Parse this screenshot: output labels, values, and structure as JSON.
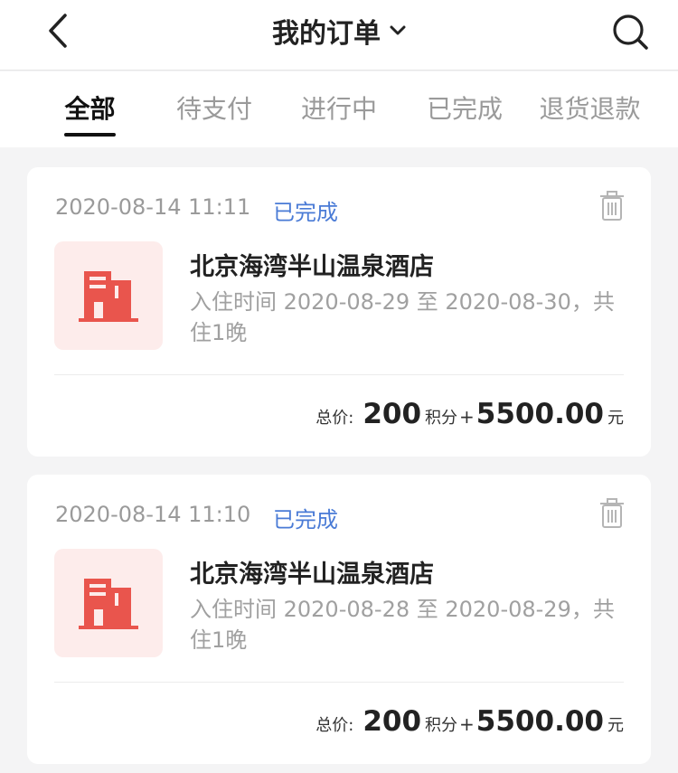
{
  "header": {
    "title": "我的订单",
    "back_icon": "back-arrow-icon",
    "dropdown_icon": "chevron-down-icon",
    "search_icon": "search-icon"
  },
  "tabs": [
    {
      "label": "全部",
      "active": true
    },
    {
      "label": "待支付",
      "active": false
    },
    {
      "label": "进行中",
      "active": false
    },
    {
      "label": "已完成",
      "active": false
    },
    {
      "label": "退货退款",
      "active": false
    }
  ],
  "orders": [
    {
      "date": "2020-08-14 11:11",
      "status": "已完成",
      "hotel": "北京海湾半山温泉酒店",
      "stay": "入住时间 2020-08-29 至 2020-08-30，共住1晚",
      "price_label": "总价:",
      "points": "200",
      "points_unit": "积分",
      "plus": "+",
      "amount": "5500.00",
      "currency": "元"
    },
    {
      "date": "2020-08-14 11:10",
      "status": "已完成",
      "hotel": "北京海湾半山温泉酒店",
      "stay": "入住时间 2020-08-28 至 2020-08-29，共住1晚",
      "price_label": "总价:",
      "points": "200",
      "points_unit": "积分",
      "plus": "+",
      "amount": "5500.00",
      "currency": "元"
    }
  ],
  "colors": {
    "accent_blue": "#4a7bd6",
    "hotel_icon_red": "#e9554d",
    "hotel_icon_bg": "#fdeceb"
  }
}
